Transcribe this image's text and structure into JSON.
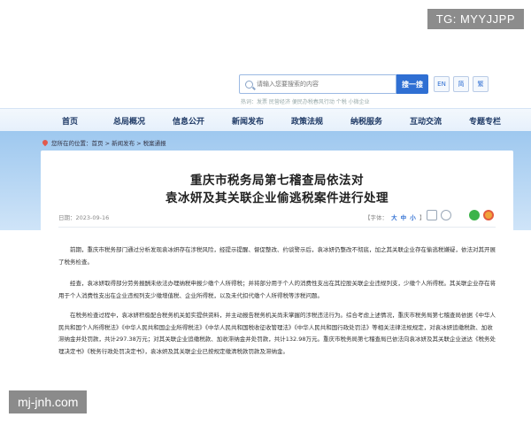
{
  "watermarks": {
    "top": "TG: MYYJJPP",
    "bottom": "mj-jnh.com"
  },
  "search": {
    "placeholder": "请输入您要搜索的内容",
    "button": "搜一搜",
    "languages": [
      "EN",
      "简",
      "繁"
    ],
    "hot_words": "热词：发票  民营经济  便民办税春风行动  个税  小微企业"
  },
  "nav": [
    "首页",
    "总局概况",
    "信息公开",
    "新闻发布",
    "政策法规",
    "纳税服务",
    "互动交流",
    "专题专栏"
  ],
  "breadcrumb": "您所在的位置：首页 > 新闻发布 > 税案通报",
  "article": {
    "title_line1": "重庆市税务局第七稽查局依法对",
    "title_line2": "袁冰妍及其关联企业偷逃税案件进行处理",
    "date": "日期：2023-09-16",
    "font_label": "【字体：",
    "font_sizes": [
      "大",
      "中",
      "小"
    ],
    "font_end": "】",
    "toolbar_icons": [
      "print-icon",
      "share-icon",
      "wechat-icon",
      "weibo-icon"
    ],
    "paragraphs": [
      "前期，重庆市税务部门通过分析发现袁冰妍存在涉税风险，经提示提醒、督促整改、约谈警示后，袁冰妍仍整改不彻底，加之其关联企业存在偷逃税嫌疑，依法对其开展了税务检查。",
      "经查，袁冰妍取得部分劳务报酬未依法办理纳税申报少缴个人所得税；并将部分用于个人的消费性支出在其控股关联企业违规列支，少缴个人所得税。其关联企业存在将用于个人消费性支出在企业违规列支少缴增值税、企业所得税，以及未代扣代缴个人所得税等涉税问题。",
      "在税务检查过程中，袁冰妍积极配合税务机关如实提供资料，并主动报告税务机关尚未掌握的涉税违法行为。综合考虑上述情况，重庆市税务局第七稽查局依据《中华人民共和国个人所得税法》《中华人民共和国企业所得税法》《中华人民共和国税收征收管理法》《中华人民共和国行政处罚法》等相关法律法规规定，对袁冰妍追缴税款、加收滞纳金并处罚款，共计297.38万元；对其关联企业追缴税款、加收滞纳金并处罚款，共计132.98万元。重庆市税务局第七稽查局已依法向袁冰妍及其关联企业送达《税务处理决定书》《税务行政处罚决定书》，袁冰妍及其关联企业已按规定缴清税款罚款及滞纳金。"
    ]
  },
  "colors": {
    "accent": "#2f6fd3",
    "nav_text": "#1f3a66",
    "hero": "#9ec8ef"
  }
}
